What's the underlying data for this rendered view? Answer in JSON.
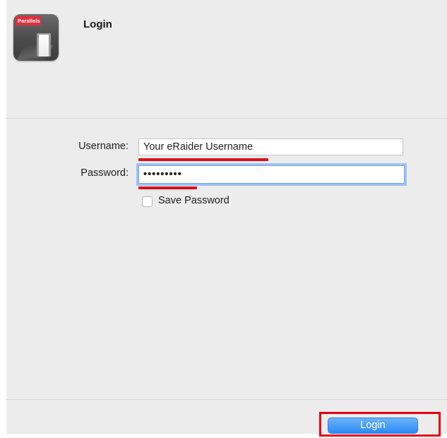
{
  "dialog": {
    "title": "Login",
    "app_icon": {
      "name": "parallels-client-icon",
      "brand_text": "Parallels",
      "brand_color": "#e0303d"
    }
  },
  "form": {
    "username": {
      "label": "Username:",
      "value": "Your eRaider Username"
    },
    "password": {
      "label": "Password:",
      "value": "•••••••••"
    },
    "save_password": {
      "label": "Save Password",
      "checked": false
    }
  },
  "footer": {
    "login_label": "Login"
  },
  "annotation_color": "#e0101a",
  "accent_color": "#2a8af6"
}
